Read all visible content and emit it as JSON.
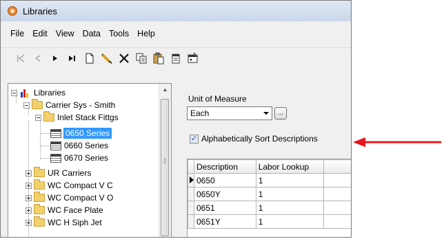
{
  "window": {
    "title": "Libraries"
  },
  "menu": [
    "File",
    "Edit",
    "View",
    "Data",
    "Tools",
    "Help"
  ],
  "toolbar": {
    "icons": [
      "first-record-icon",
      "previous-record-icon",
      "next-record-icon",
      "last-record-icon",
      "new-record-icon",
      "edit-pencil-icon",
      "delete-icon",
      "copy-icon",
      "paste-icon",
      "notes-icon",
      "properties-icon"
    ]
  },
  "tree": {
    "root": "Libraries",
    "group": "Carrier Sys - Smith",
    "subgroup": "Inlet Stack Fittgs",
    "items": [
      "0650 Series",
      "0660 Series",
      "0670 Series"
    ],
    "folders": [
      "UR Carriers",
      "WC Compact V C",
      "WC Compact V O",
      "WC Face Plate",
      "WC H Siph Jet"
    ]
  },
  "unit_of_measure": {
    "label": "Unit of Measure",
    "value": "Each",
    "ellipsis": "..."
  },
  "sort": {
    "label": "Alphabetically Sort Descriptions",
    "checked_mark": "✓"
  },
  "grid": {
    "headers": [
      "Description",
      "Labor Lookup"
    ],
    "rows": [
      [
        "0650",
        "1"
      ],
      [
        "0650Y",
        "1"
      ],
      [
        "0651",
        "1"
      ],
      [
        "0651Y",
        "1"
      ]
    ]
  },
  "colors": {
    "selection": "#3399ff",
    "annotation_arrow": "#e8141b"
  }
}
